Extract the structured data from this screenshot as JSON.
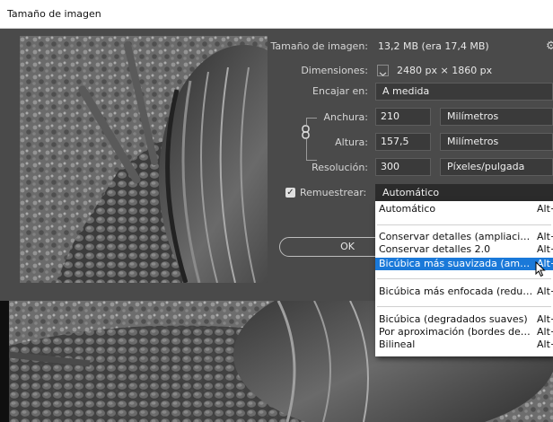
{
  "window": {
    "title": "Tamaño de imagen"
  },
  "info": {
    "size_label": "Tamaño de imagen:",
    "size_value": "13,2 MB (era 17,4 MB)",
    "dimensions_label": "Dimensiones:",
    "dimensions_value": "2480 px × 1860 px",
    "fit_label": "Encajar en:",
    "fit_value": "A medida"
  },
  "fields": {
    "width_label": "Anchura:",
    "width_value": "210",
    "width_unit": "Milímetros",
    "height_label": "Altura:",
    "height_value": "157,5",
    "height_unit": "Milímetros",
    "resolution_label": "Resolución:",
    "resolution_value": "300",
    "resolution_unit": "Píxeles/pulgada"
  },
  "resample": {
    "label": "Remuestrear:",
    "checked": true,
    "selected": "Automático"
  },
  "ok_label": "OK",
  "menu": {
    "items": [
      {
        "label": "Automático",
        "shortcut": "Alt+",
        "highlighted": false
      },
      {
        "label": "Conservar detalles (ampliación)",
        "shortcut": "Alt+",
        "highlighted": false
      },
      {
        "label": "Conservar detalles 2.0",
        "shortcut": "Alt+",
        "highlighted": false
      },
      {
        "label": "Bicúbica más suavizada (ampliación)",
        "shortcut": "Alt+",
        "highlighted": true
      },
      {
        "label": "Bicúbica más enfocada (reducción)",
        "shortcut": "Alt+",
        "highlighted": false
      },
      {
        "label": "Bicúbica (degradados suaves)",
        "shortcut": "Alt+",
        "highlighted": false
      },
      {
        "label": "Por aproximación (bordes definidos)",
        "shortcut": "Alt+",
        "highlighted": false
      },
      {
        "label": "Bilineal",
        "shortcut": "Alt+",
        "highlighted": false
      }
    ]
  },
  "colors": {
    "dialog_bg": "#4a4a4a",
    "highlight": "#1a79d9",
    "title_bg": "#ffffff"
  }
}
